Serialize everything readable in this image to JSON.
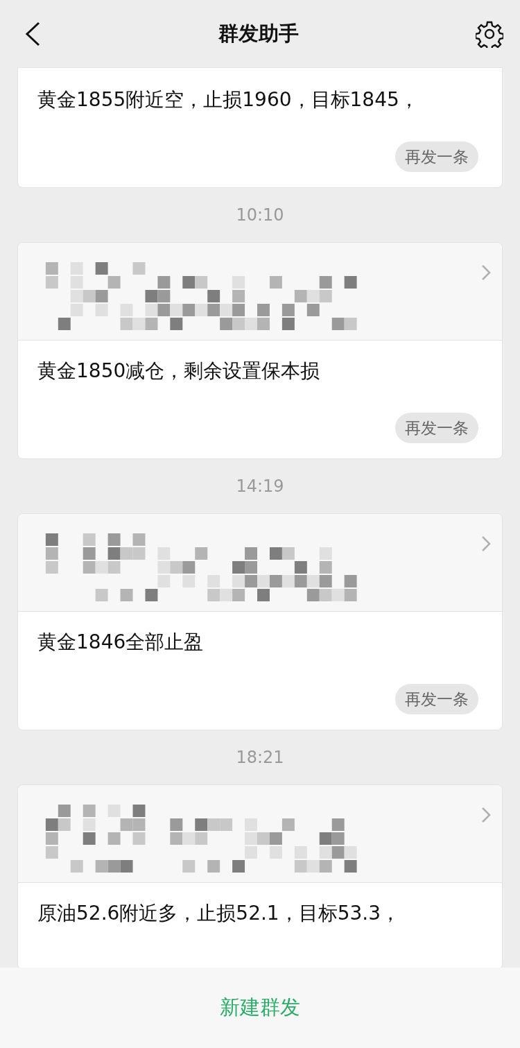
{
  "header": {
    "title": "群发助手"
  },
  "messages": [
    {
      "recipients_hidden": false,
      "text": "黄金1855附近空，止损1960，目标1845，",
      "resend": "再发一条"
    },
    {
      "time": "10:10",
      "recipients_hidden": true,
      "text": "黄金1850减仓，剩余设置保本损",
      "resend": "再发一条"
    },
    {
      "time": "14:19",
      "recipients_hidden": true,
      "text": "黄金1846全部止盈",
      "resend": "再发一条"
    },
    {
      "time": "18:21",
      "recipients_hidden": true,
      "text": "原油52.6附近多，止损52.1，目标53.3，"
    }
  ],
  "bottom_bar": {
    "action": "新建群发"
  }
}
